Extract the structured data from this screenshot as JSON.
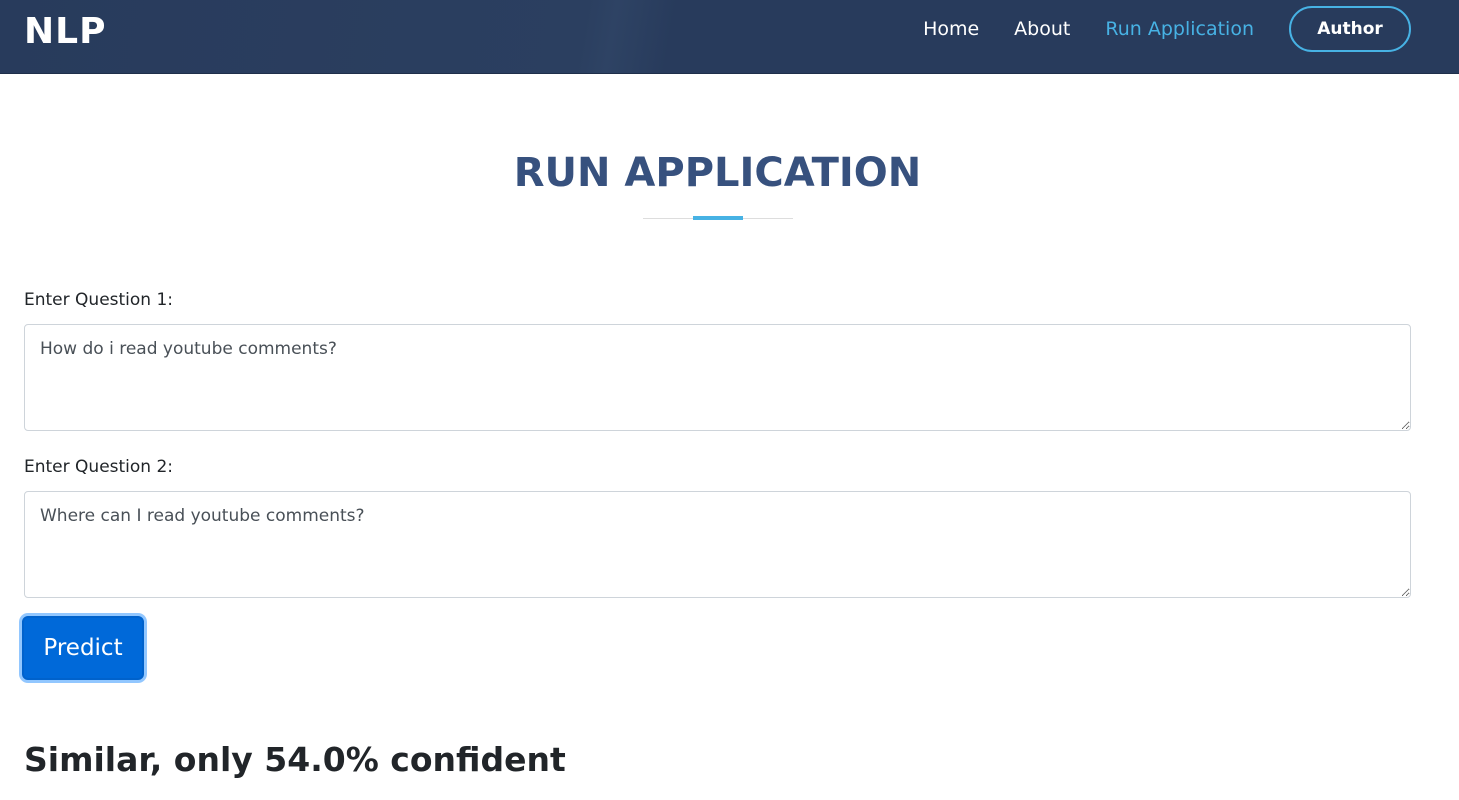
{
  "header": {
    "brand": "NLP",
    "nav": {
      "home": "Home",
      "about": "About",
      "run_application": "Run Application",
      "author": "Author"
    }
  },
  "main": {
    "title": "RUN APPLICATION",
    "question1": {
      "label": "Enter Question 1:",
      "value": "How do i read youtube comments?"
    },
    "question2": {
      "label": "Enter Question 2:",
      "value": "Where can I read youtube comments?"
    },
    "predict_label": "Predict",
    "result": "Similar, only 54.0% confident"
  },
  "colors": {
    "navbar_bg": "#283b5c",
    "accent": "#47b2e4",
    "title": "#37517e",
    "button": "#0069d9"
  }
}
